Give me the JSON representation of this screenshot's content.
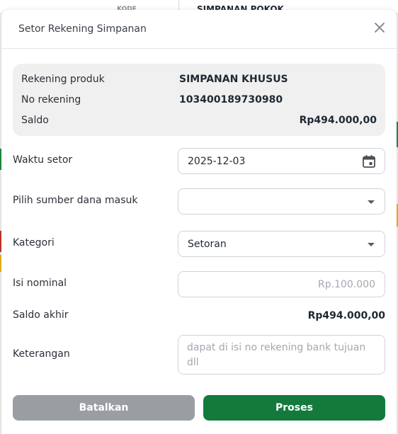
{
  "background": {
    "left_hint": "KODE",
    "right_hint": "SIMPANAN POKOK"
  },
  "modal": {
    "title": "Setor Rekening Simpanan",
    "close_icon": "close-icon"
  },
  "account_info": {
    "product_label": "Rekening produk",
    "product_value": "SIMPANAN KHUSUS",
    "number_label": "No rekening",
    "number_value": "103400189730980",
    "balance_label": "Saldo",
    "balance_value": "Rp494.000,00"
  },
  "form": {
    "deposit_time_label": "Waktu setor",
    "deposit_time_value": "2025-12-03",
    "deposit_time_icon": "calendar-icon",
    "source_label": "Pilih sumber dana masuk",
    "source_value": "",
    "category_label": "Kategori",
    "category_value": "Setoran",
    "nominal_label": "Isi nominal",
    "nominal_placeholder": "Rp.100.000",
    "final_balance_label": "Saldo akhir",
    "final_balance_value": "Rp494.000,00",
    "notes_label": "Keterangan",
    "notes_placeholder": "dapat di isi no rekening bank tujuan dll"
  },
  "actions": {
    "cancel_label": "Batalkan",
    "process_label": "Proses"
  },
  "colors": {
    "primary": "#137a3c",
    "cancel": "#9a9ea3",
    "info_bg": "#f0f0f0"
  }
}
